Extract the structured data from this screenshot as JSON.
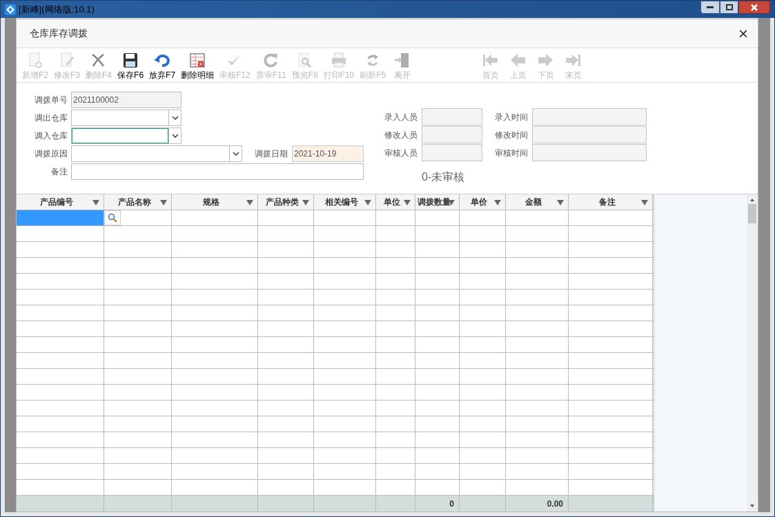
{
  "window": {
    "title": "[新峰](网络版:10.1)"
  },
  "dialog": {
    "title": "仓库库存调拨",
    "close": "×"
  },
  "toolbar": [
    {
      "kind": "new",
      "label": "新增F2",
      "disabled": true
    },
    {
      "kind": "edit",
      "label": "修改F3",
      "disabled": true
    },
    {
      "kind": "delete",
      "label": "删除F4",
      "disabled": true
    },
    {
      "kind": "save",
      "label": "保存F6",
      "disabled": false
    },
    {
      "kind": "undo",
      "label": "放弃F7",
      "disabled": false
    },
    {
      "kind": "delete-detail",
      "label": "删除明细",
      "disabled": false
    },
    {
      "kind": "audit",
      "label": "审核F12",
      "disabled": true
    },
    {
      "kind": "unaudit",
      "label": "弃审F11",
      "disabled": true
    },
    {
      "kind": "preview",
      "label": "预览F8",
      "disabled": true
    },
    {
      "kind": "print",
      "label": "打印F10",
      "disabled": true
    },
    {
      "kind": "refresh",
      "label": "刷新F5",
      "disabled": true
    },
    {
      "kind": "exit",
      "label": "离开",
      "disabled": true
    }
  ],
  "pager": [
    {
      "kind": "first",
      "label": "首页",
      "disabled": true
    },
    {
      "kind": "prev",
      "label": "上页",
      "disabled": true
    },
    {
      "kind": "next",
      "label": "下页",
      "disabled": true
    },
    {
      "kind": "last",
      "label": "末页",
      "disabled": true
    }
  ],
  "form": {
    "left": [
      {
        "label": "调拨单号",
        "kind": "text",
        "value": "2021100002",
        "readonly": true,
        "focused": false
      },
      {
        "label": "调出仓库",
        "kind": "dropdown",
        "readonly": false,
        "focused": false
      },
      {
        "label": "调入仓库",
        "kind": "dropdown",
        "readonly": false,
        "focused": true
      },
      {
        "label": "调拨原因",
        "kind": "dropdown",
        "readonly": false,
        "focused": false,
        "side_label": "调拨日期",
        "side_value": "2021-10-19"
      },
      {
        "label": "备注",
        "kind": "wide",
        "readonly": false,
        "focused": false
      }
    ],
    "audit": [
      {
        "label": "录入人员",
        "time_label": "录入时间"
      },
      {
        "label": "修改人员",
        "time_label": "修改时间"
      },
      {
        "label": "审核人员",
        "time_label": "审核时间"
      }
    ],
    "status": "0-未审核"
  },
  "grid": {
    "columns": [
      {
        "label": "产品编号"
      },
      {
        "label": "产品名称"
      },
      {
        "label": "规格"
      },
      {
        "label": "产品种类"
      },
      {
        "label": "相关编号"
      },
      {
        "label": "单位"
      },
      {
        "label": "调拨数量",
        "footer": "0"
      },
      {
        "label": "单价"
      },
      {
        "label": "金额",
        "footer": "0.00"
      },
      {
        "label": "备注"
      }
    ]
  }
}
